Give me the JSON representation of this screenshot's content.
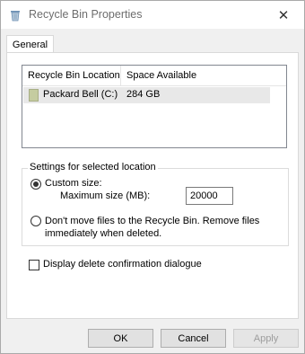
{
  "window": {
    "title": "Recycle Bin Properties",
    "close_glyph": "✕",
    "icon": "recycle-bin-icon"
  },
  "tabs": [
    {
      "label": "General",
      "selected": true
    }
  ],
  "list": {
    "columns": [
      "Recycle Bin Location",
      "Space Available"
    ],
    "rows": [
      {
        "location": "Packard Bell (C:)",
        "space": "284 GB",
        "icon": "drive-icon",
        "selected": true
      }
    ]
  },
  "settings": {
    "group_label": "Settings for selected location",
    "custom_size_label": "Custom size:",
    "max_size_label": "Maximum size (MB):",
    "max_size_value": "20000",
    "dont_move_label": "Don't move files to the Recycle Bin. Remove files immediately when deleted.",
    "selected_option": "custom_size"
  },
  "confirm": {
    "label": "Display delete confirmation dialogue",
    "checked": false
  },
  "buttons": {
    "ok": "OK",
    "cancel": "Cancel",
    "apply": "Apply"
  },
  "colors": {
    "drive_icon": "#c5cca0",
    "row_highlight": "#e8e8e8"
  }
}
